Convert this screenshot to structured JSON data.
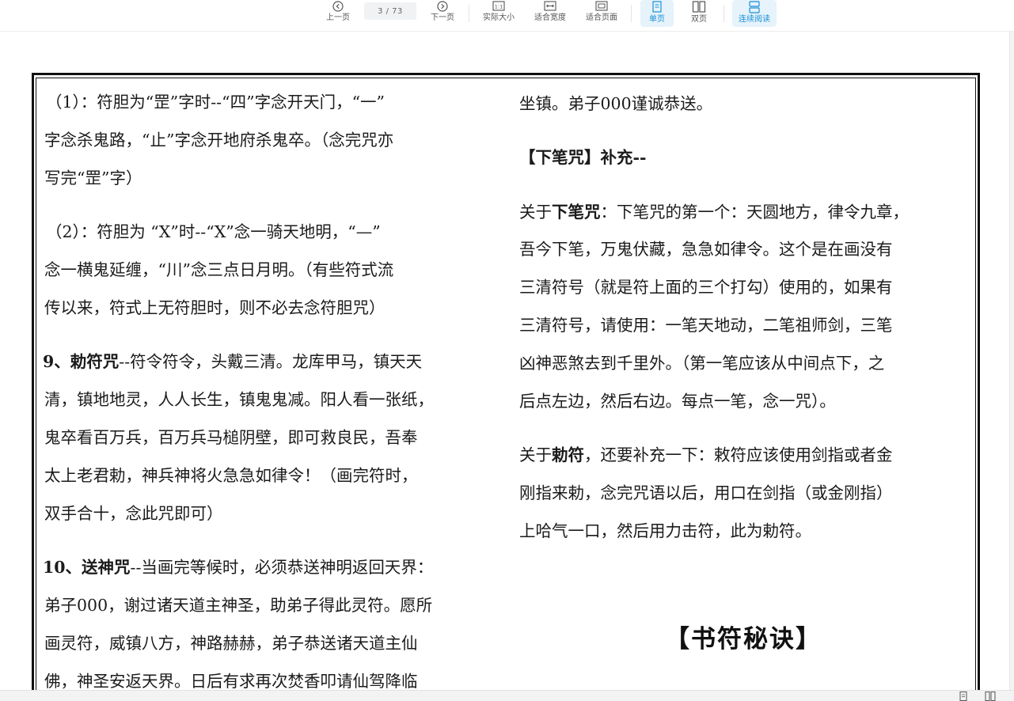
{
  "toolbar": {
    "prev_label": "上一页",
    "page_indicator": "3 / 73",
    "next_label": "下一页",
    "actual_size_label": "实际大小",
    "fit_width_label": "适合宽度",
    "fit_page_label": "适合页面",
    "single_page_label": "单页",
    "double_page_label": "双页",
    "continuous_label": "连续阅读",
    "actual_size_icon_text": "1:1"
  },
  "left_column": [
    "（1）：符胆为“罡”字时--“四”字念开天门，“一”",
    "字念杀鬼路，“止”字念开地府杀鬼卒。（念完咒亦",
    "写完“罡”字）",
    "（2）：符胆为 “X”时--“X”念一骑天地明，“—”",
    "念一横鬼延缠，“川”念三点日月明。（有些符式流",
    "传以来，符式上无符胆时，则不必去念符胆咒）",
    "--符令符令，头戴三清。龙库甲马，镇天天",
    "清，镇地地灵，人人长生，镇鬼鬼减。阳人看一张纸，",
    "鬼卒看百万兵，百万兵马槌阴壁，即可救良民，吾奉",
    "太上老君勅，神兵神将火急急如律令！（画完符时，",
    "双手合十，念此咒即可）",
    "--当画完等候时，必须恭送神明返回天界：",
    "弟子000，谢过诸天道主神圣，助弟子得此灵符。愿所",
    "画灵符，威镇八方，神路赫赫，弟子恭送诸天道主仙",
    "佛，神圣安返天界。日后有求再次焚香叩请仙驾降临"
  ],
  "left_bold": {
    "item9": "9、勅符咒",
    "item10": "10、送神咒"
  },
  "right_column": [
    "坐镇。弟子000谨诚恭送。",
    "补充--",
    "：下笔咒的第一个：天圆地方，律令九章，",
    "吾今下笔，万鬼伏藏，急急如律令。这个是在画没有",
    "三清符号（就是符上面的三个打勾）使用的，如果有",
    "三清符号，请使用：一笔天地动，二笔祖师剑，三笔",
    "凶神恶煞去到千里外。（第一笔应该从中间点下，之",
    "后点左边，然后右边。每点一笔，念一咒）。",
    "，还要补充一下：敕符应该使用剑指或者金",
    "刚指来勅，念完咒语以后，用口在剑指（或金刚指）",
    "上哈气一口，然后用力击符，此为勅符。"
  ],
  "right_bold": {
    "xiabi_title": "【下笔咒】",
    "guanyu1": "关于",
    "xiabi": "下笔咒",
    "guanyu2": "关于",
    "chifu": "勅符"
  },
  "section_title": "【书符秘诀】",
  "colors": {
    "accent": "#1a8fd6",
    "active_bg": "#e6f3fb",
    "text": "#1b1b1b"
  }
}
